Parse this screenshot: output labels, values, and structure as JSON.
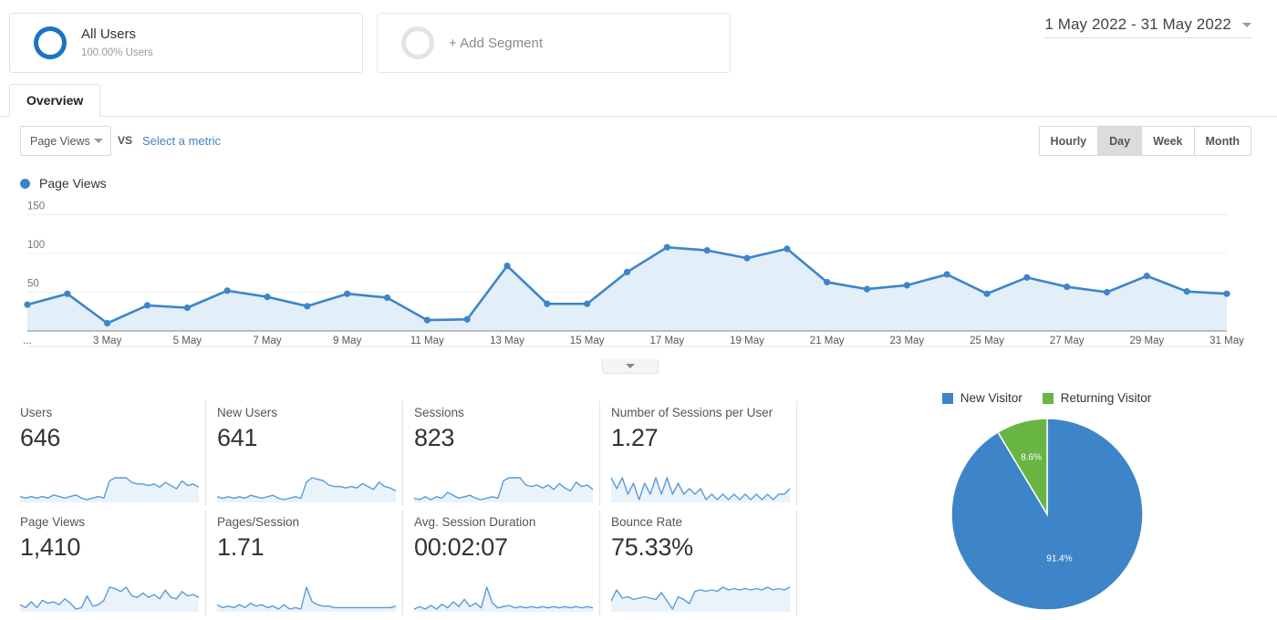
{
  "segments": [
    {
      "name": "All Users",
      "sub": "100.00% Users",
      "icon": "donut-icon",
      "state": "active"
    },
    {
      "name": "+ Add Segment",
      "icon": "empty-donut-icon",
      "state": "add"
    }
  ],
  "date_range": {
    "label": "1 May 2022 - 31 May 2022",
    "icon": "chevron-down-icon"
  },
  "tabs": [
    {
      "label": "Overview",
      "active": true
    }
  ],
  "controls": {
    "metric_select": "Page Views",
    "vs_label": "VS",
    "select_metric_link": "Select a metric",
    "granularity": [
      {
        "label": "Hourly",
        "active": false
      },
      {
        "label": "Day",
        "active": true
      },
      {
        "label": "Week",
        "active": false
      },
      {
        "label": "Month",
        "active": false
      }
    ]
  },
  "chart_legend": {
    "label": "Page Views",
    "color": "#3d85c8"
  },
  "chart_data": {
    "type": "line",
    "title": "Page Views",
    "xlabel": "",
    "ylabel": "Page Views",
    "ylim": [
      0,
      160
    ],
    "yticks": [
      50,
      100,
      150
    ],
    "grid": true,
    "legend_position": "top-left",
    "line_color": "#3d85c8",
    "fill_color": "#e2eef8",
    "x": [
      "1 May",
      "2 May",
      "3 May",
      "4 May",
      "5 May",
      "6 May",
      "7 May",
      "8 May",
      "9 May",
      "10 May",
      "11 May",
      "12 May",
      "13 May",
      "14 May",
      "15 May",
      "16 May",
      "17 May",
      "18 May",
      "19 May",
      "20 May",
      "21 May",
      "22 May",
      "23 May",
      "24 May",
      "25 May",
      "26 May",
      "27 May",
      "28 May",
      "29 May",
      "30 May",
      "31 May"
    ],
    "xtick_labels": [
      "...",
      "3 May",
      "5 May",
      "7 May",
      "9 May",
      "11 May",
      "13 May",
      "15 May",
      "17 May",
      "19 May",
      "21 May",
      "23 May",
      "25 May",
      "27 May",
      "29 May",
      "31 May"
    ],
    "values": [
      34,
      48,
      10,
      33,
      30,
      52,
      44,
      32,
      48,
      43,
      14,
      15,
      84,
      35,
      35,
      76,
      108,
      104,
      94,
      106,
      63,
      54,
      59,
      73,
      48,
      69,
      57,
      50,
      71,
      51,
      48
    ]
  },
  "collapse_handle": {
    "icon": "chevron-down-icon"
  },
  "metric_cards": [
    {
      "title": "Users",
      "value": "646",
      "spark": [
        12,
        11,
        12,
        11,
        12,
        11,
        13,
        12,
        11,
        12,
        13,
        11,
        10,
        11,
        12,
        11,
        22,
        24,
        24,
        24,
        21,
        20,
        20,
        19,
        20,
        18,
        21,
        19,
        17,
        22,
        19,
        20,
        18
      ]
    },
    {
      "title": "New Users",
      "value": "641",
      "spark": [
        11,
        10,
        11,
        10,
        11,
        10,
        12,
        11,
        10,
        11,
        12,
        10,
        9,
        10,
        11,
        10,
        21,
        24,
        23,
        22,
        19,
        18,
        18,
        17,
        18,
        17,
        20,
        18,
        16,
        21,
        18,
        17,
        15
      ]
    },
    {
      "title": "Sessions",
      "value": "823",
      "spark": [
        11,
        10,
        12,
        10,
        12,
        11,
        15,
        13,
        11,
        12,
        13,
        11,
        10,
        11,
        12,
        11,
        23,
        25,
        25,
        25,
        20,
        19,
        20,
        18,
        20,
        17,
        21,
        18,
        16,
        22,
        19,
        20,
        17
      ]
    },
    {
      "title": "Number of Sessions per User",
      "value": "1.27",
      "spark": [
        22,
        20,
        22,
        19,
        21,
        18,
        21,
        19,
        22,
        19,
        22,
        19,
        21,
        19,
        20,
        19,
        20,
        18,
        19,
        18,
        19,
        18,
        19,
        18,
        19,
        18,
        19,
        18,
        19,
        18,
        19,
        19,
        20
      ]
    },
    {
      "title": "Page Views",
      "value": "1,410",
      "spark": [
        14,
        12,
        16,
        12,
        17,
        15,
        16,
        14,
        18,
        15,
        11,
        12,
        20,
        13,
        14,
        17,
        26,
        25,
        23,
        26,
        20,
        19,
        22,
        19,
        21,
        18,
        24,
        19,
        18,
        23,
        20,
        21,
        19
      ]
    },
    {
      "title": "Pages/Session",
      "value": "1.71",
      "spark": [
        16,
        14,
        15,
        14,
        16,
        14,
        17,
        15,
        16,
        14,
        15,
        13,
        16,
        13,
        14,
        13,
        28,
        18,
        16,
        15,
        15,
        14,
        14,
        14,
        14,
        14,
        14,
        14,
        14,
        14,
        14,
        14,
        15
      ]
    },
    {
      "title": "Avg. Session Duration",
      "value": "00:02:07",
      "spark": [
        10,
        12,
        10,
        13,
        10,
        14,
        11,
        16,
        12,
        18,
        12,
        15,
        11,
        28,
        15,
        11,
        12,
        13,
        11,
        12,
        11,
        12,
        11,
        12,
        11,
        12,
        11,
        12,
        11,
        12,
        11,
        12,
        11
      ]
    },
    {
      "title": "Bounce Rate",
      "value": "75.33%",
      "spark": [
        14,
        22,
        16,
        17,
        15,
        16,
        17,
        16,
        15,
        20,
        14,
        8,
        17,
        15,
        12,
        21,
        22,
        21,
        22,
        21,
        24,
        22,
        23,
        22,
        23,
        22,
        23,
        22,
        24,
        22,
        23,
        22,
        24
      ]
    }
  ],
  "pie": {
    "legend": [
      {
        "label": "New Visitor",
        "color": "#3d85c8"
      },
      {
        "label": "Returning Visitor",
        "color": "#69b544"
      }
    ],
    "type": "pie",
    "slices": [
      {
        "label": "New Visitor",
        "value": 91.4,
        "display": "91.4%",
        "color": "#3d85c8"
      },
      {
        "label": "Returning Visitor",
        "value": 8.6,
        "display": "8.6%",
        "color": "#69b544"
      }
    ]
  }
}
